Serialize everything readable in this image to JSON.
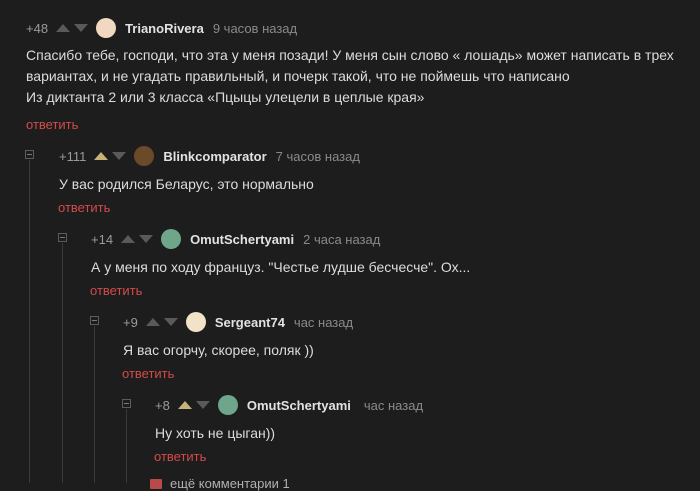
{
  "comments": [
    {
      "rating": "+48",
      "author": "TrianoRivera",
      "time": "9 часов назад",
      "lines": [
        "Спасибо тебе, господи, что эта у меня позади! У меня сын слово « лошадь» может написать в трех",
        "вариантах, и не угадать правильный, и почерк такой, что не поймешь что написано",
        "Из диктанта 2 или 3 класса «Пцыцы улецели в цеплые края»"
      ],
      "reply": "ответить",
      "avatar_color": "#f0d9c0"
    },
    {
      "rating": "+111",
      "author": "Blinkcomparator",
      "time": "7 часов назад",
      "lines": [
        "У вас родился Беларус, это нормально"
      ],
      "reply": "ответить",
      "avatar_color": "#6b4a2a"
    },
    {
      "rating": "+14",
      "author": "OmutSchertyami",
      "time": "2 часа назад",
      "lines": [
        "А у меня по ходу француз. \"Честье лудше бесчесче\". Ох..."
      ],
      "reply": "ответить",
      "avatar_color": "#6fa58a"
    },
    {
      "rating": "+9",
      "author": "Sergeant74",
      "time": "час назад",
      "lines": [
        "Я вас огорчу, скорее, поляк ))"
      ],
      "reply": "ответить",
      "avatar_color": "#f2e3c8"
    },
    {
      "rating": "+8",
      "author": "OmutSchertyami",
      "time": "час назад",
      "lines": [
        "Ну хоть не цыган))"
      ],
      "reply": "ответить",
      "avatar_color": "#6fa58a"
    }
  ],
  "more": {
    "label": "ещё комментарии 1"
  },
  "colors": {
    "background": "#1d1d1d",
    "reply": "#d44a4a",
    "upvote_active": "#c8b27a"
  }
}
